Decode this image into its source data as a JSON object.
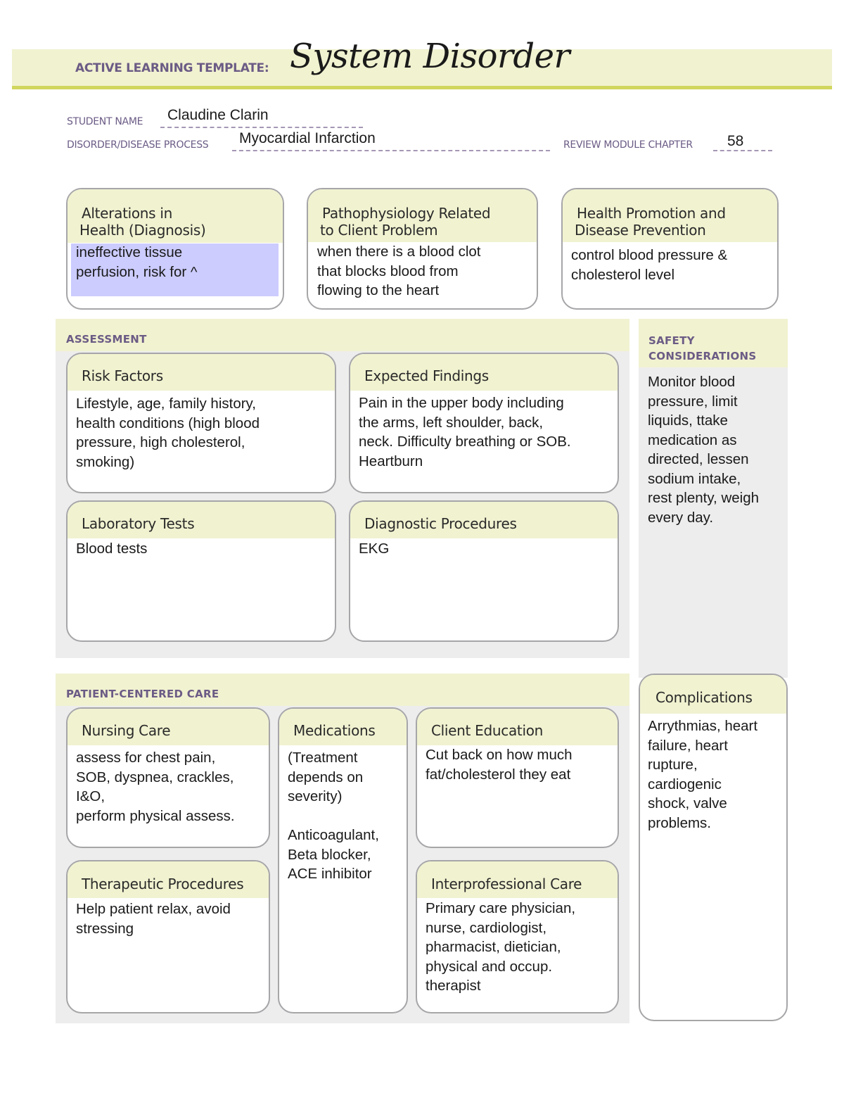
{
  "header": {
    "template_label": "ACTIVE LEARNING TEMPLATE:",
    "template_title": "System Disorder"
  },
  "meta": {
    "student_name_label": "STUDENT NAME",
    "student_name_value": "Claudine Clarin",
    "disorder_label": "DISORDER/DISEASE PROCESS",
    "disorder_value": "Myocardial Infarction",
    "chapter_label": "REVIEW MODULE CHAPTER",
    "chapter_value": "58"
  },
  "top_boxes": {
    "alterations": {
      "title_line1": "Alterations in",
      "title_line2": "Health (Diagnosis)",
      "body": "ineffective tissue\nperfusion, risk for ^",
      "highlight_color": "#ccccff"
    },
    "pathophysiology": {
      "title_line1": "Pathophysiology Related",
      "title_line2": "to Client Problem",
      "body": "when there is a blood clot\nthat blocks blood from\nflowing to the heart"
    },
    "health_promotion": {
      "title_line1": "Health Promotion and",
      "title_line2": "Disease Prevention",
      "body": "control blood pressure &\ncholesterol level"
    }
  },
  "assessment": {
    "section_label": "ASSESSMENT",
    "risk_factors": {
      "title": "Risk Factors",
      "body": "Lifestyle, age, family history,\nhealth conditions (high blood\npressure, high cholesterol,\nsmoking)"
    },
    "expected_findings": {
      "title": "Expected Findings",
      "body": "Pain in the upper body including\nthe arms, left shoulder, back,\nneck. Difficulty breathing or SOB.\nHeartburn"
    },
    "laboratory_tests": {
      "title": "Laboratory Tests",
      "body": "Blood tests"
    },
    "diagnostic_procedures": {
      "title": "Diagnostic Procedures",
      "body": "EKG"
    }
  },
  "safety": {
    "section_label_line1": "SAFETY",
    "section_label_line2": "CONSIDERATIONS",
    "body": "Monitor blood\npressure, limit\nliquids, ttake\nmedication as\ndirected, lessen\nsodium intake,\nrest plenty, weigh\nevery day."
  },
  "patient_centered_care": {
    "section_label": "PATIENT-CENTERED CARE",
    "nursing_care": {
      "title": "Nursing Care",
      "body": "assess for chest pain,\nSOB, dyspnea, crackles,\nI&O,\nperform physical assess."
    },
    "medications": {
      "title": "Medications",
      "body": "(Treatment\ndepends on\nseverity)\n\nAnticoagulant,\nBeta blocker,\nACE inhibitor"
    },
    "client_education": {
      "title": "Client Education",
      "body": "Cut back on how much\nfat/cholesterol they eat"
    },
    "therapeutic_procedures": {
      "title": "Therapeutic Procedures",
      "body": "Help patient relax, avoid\nstressing"
    },
    "interprofessional_care": {
      "title": "Interprofessional Care",
      "body": "Primary care physician,\nnurse, cardiologist,\npharmacist, dietician,\nphysical and occup.\ntherapist"
    }
  },
  "complications": {
    "title": "Complications",
    "body": "Arrythmias, heart\nfailure, heart\nrupture,\ncardiogenic\nshock, valve\nproblems."
  }
}
